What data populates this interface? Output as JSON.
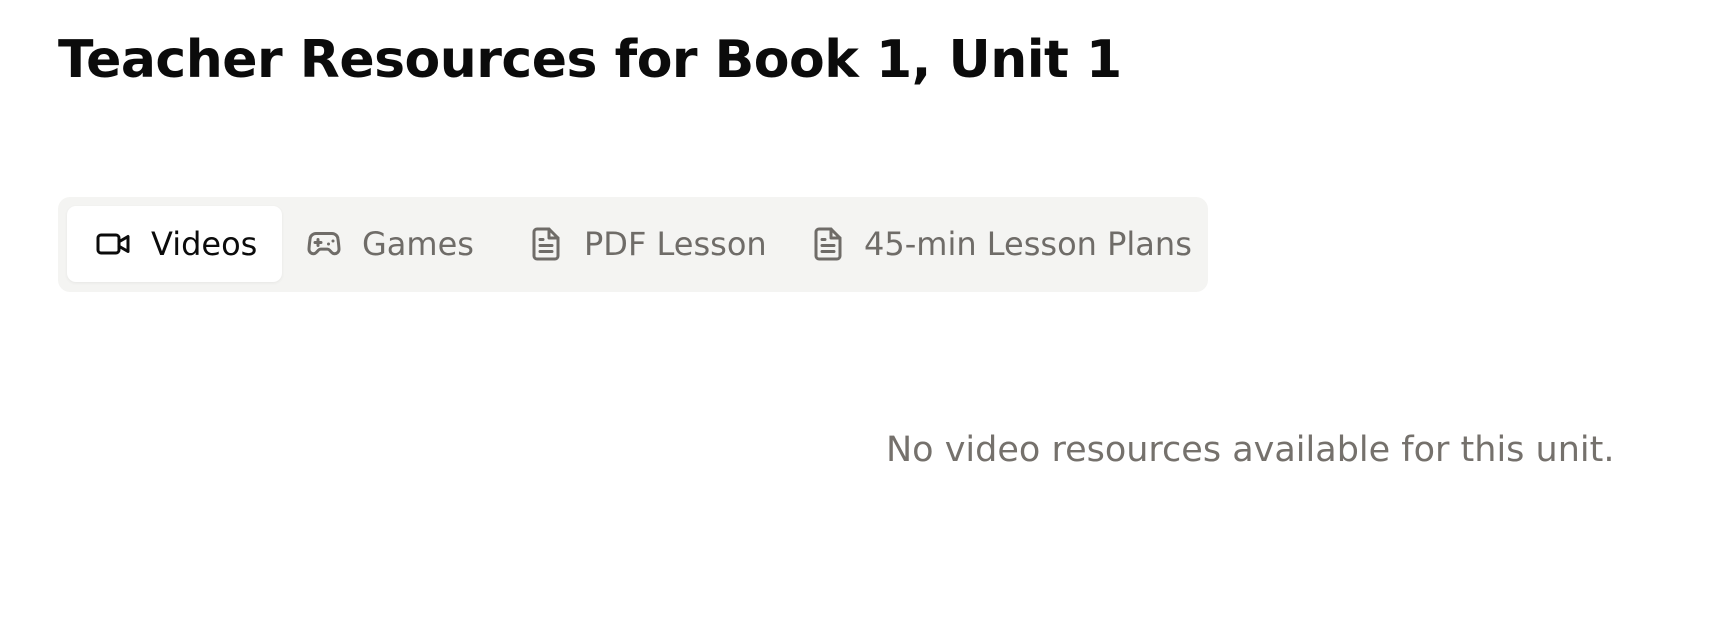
{
  "page": {
    "title": "Teacher Resources for Book 1, Unit 1"
  },
  "tabs": [
    {
      "label": "Videos",
      "icon": "video-camera-icon",
      "active": true
    },
    {
      "label": "Games",
      "icon": "gamepad-icon",
      "active": false
    },
    {
      "label": "PDF Lesson",
      "icon": "document-icon",
      "active": false
    },
    {
      "label": "45-min Lesson Plans",
      "icon": "document-icon",
      "active": false
    }
  ],
  "content": {
    "empty_message": "No video resources available for this unit."
  },
  "colors": {
    "title": "#0b0b0b",
    "tab_bar_bg": "#f4f4f2",
    "tab_active_bg": "#ffffff",
    "tab_inactive_text": "#6f6c68",
    "empty_text": "#75716c"
  }
}
